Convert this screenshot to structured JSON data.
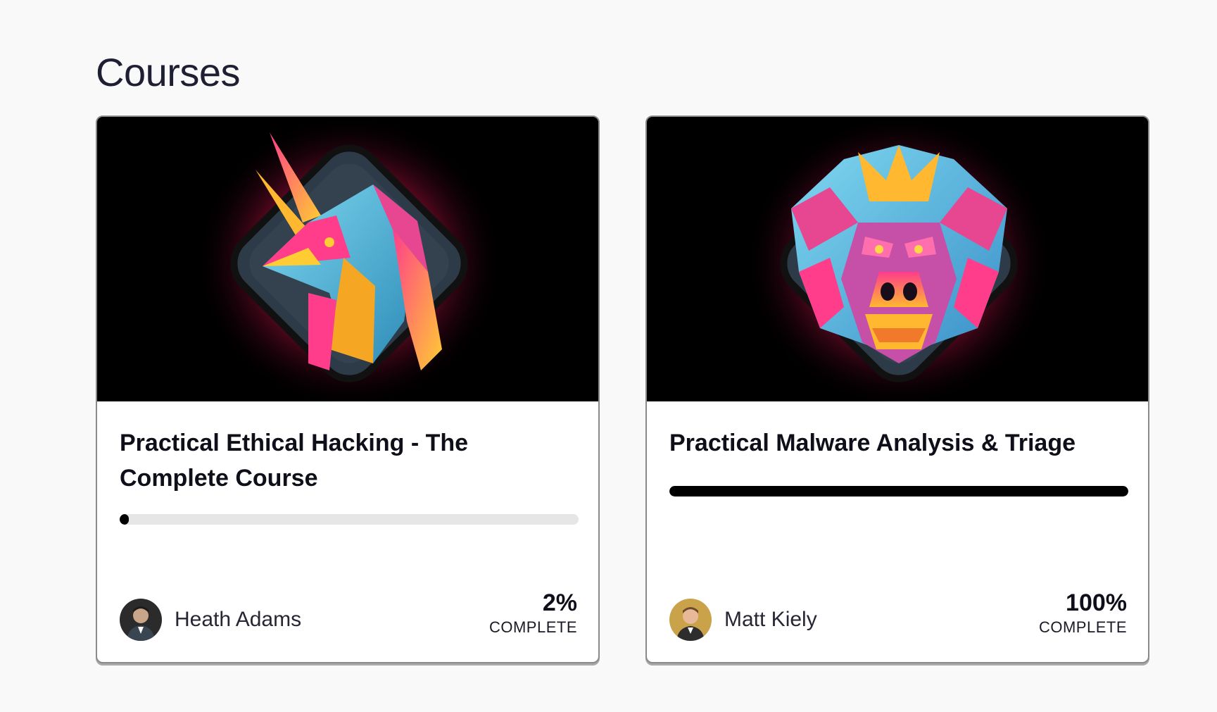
{
  "page": {
    "title": "Courses"
  },
  "courses": [
    {
      "title": "Practical Ethical Hacking - The Complete Course",
      "image_icon": "unicorn-mascot-icon",
      "author": "Heath Adams",
      "progress_percent": 2,
      "progress_text": "2%",
      "progress_label": "COMPLETE"
    },
    {
      "title": "Practical Malware Analysis & Triage",
      "image_icon": "gorilla-mascot-icon",
      "author": "Matt Kiely",
      "progress_percent": 100,
      "progress_text": "100%",
      "progress_label": "COMPLETE"
    }
  ],
  "colors": {
    "background": "#f9f9fa",
    "progress_fill": "#000000",
    "progress_track": "#e6e6e6",
    "glow": "#ff2d6f"
  }
}
